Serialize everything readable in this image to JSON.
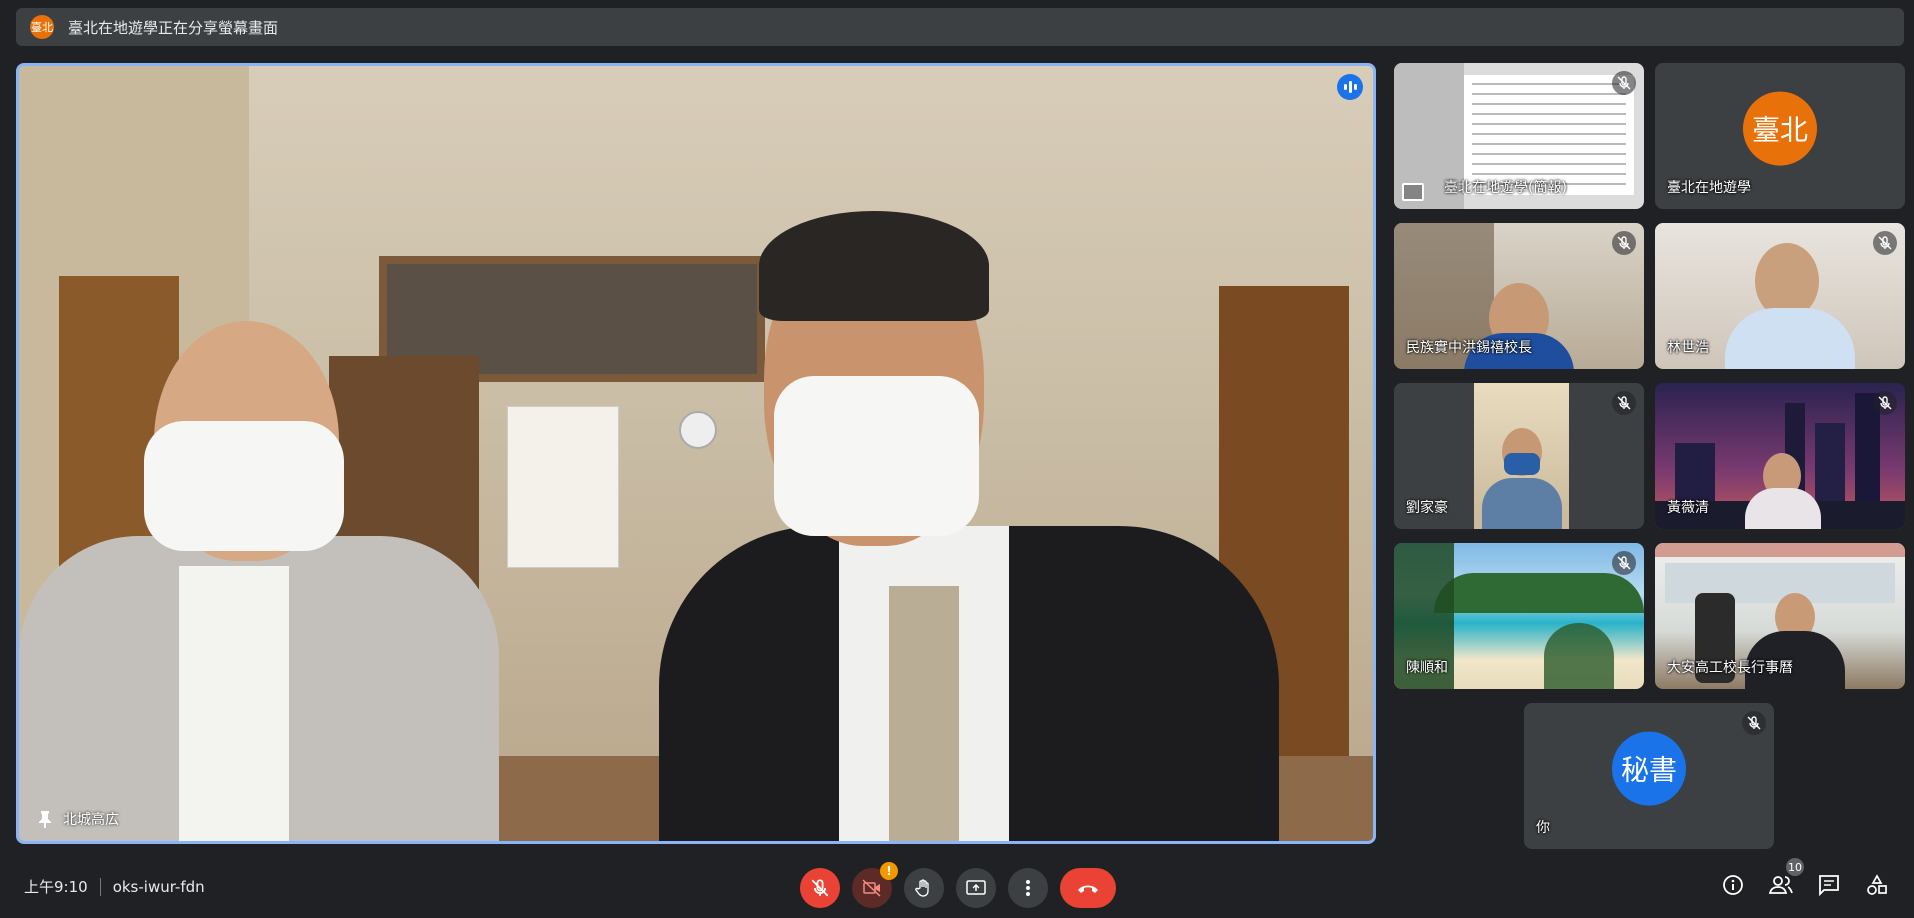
{
  "banner": {
    "avatar_text": "臺北",
    "text": "臺北在地遊學正在分享螢幕畫面"
  },
  "main_speaker": {
    "name": "北城高広",
    "speaking": true
  },
  "tiles": [
    {
      "name": "臺北在地遊學(簡報)",
      "type": "presentation",
      "muted": true
    },
    {
      "name": "臺北在地遊學",
      "type": "avatar",
      "avatar_text": "臺北",
      "avatar_color": "#e8710a",
      "muted": false
    },
    {
      "name": "民族實中洪錫禧校長",
      "type": "video",
      "muted": true
    },
    {
      "name": "林世浩",
      "type": "video",
      "muted": true
    },
    {
      "name": "劉家豪",
      "type": "video",
      "muted": true
    },
    {
      "name": "黃薇清",
      "type": "video",
      "muted": true
    },
    {
      "name": "陳順和",
      "type": "video",
      "muted": true
    },
    {
      "name": "大安高工校長行事曆",
      "type": "video",
      "muted": false
    },
    {
      "name": "你",
      "type": "avatar",
      "avatar_text": "秘書",
      "avatar_color": "#1a73e8",
      "muted": true
    }
  ],
  "bottom": {
    "time": "上午9:10",
    "meeting_code": "oks-iwur-fdn",
    "participants_count": "10",
    "camera_warning": "!"
  },
  "colors": {
    "end_call": "#ea4335",
    "accent": "#8ab4f8"
  }
}
